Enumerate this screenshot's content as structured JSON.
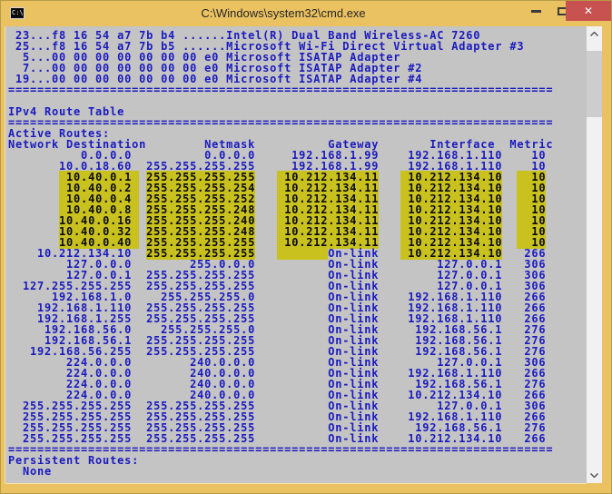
{
  "theme": {
    "titlebar_bg": "#ebc261",
    "close_bg": "#c85250",
    "console_bg": "#c4c4c4",
    "console_text": "#1a1ac0",
    "hl_bg": "#c9c11d",
    "hl_text": "#0a0a14",
    "sb_track": "#f1f1f1",
    "sb_thumb": "#cdcdcd"
  },
  "window": {
    "title": "C:\\Windows\\system32\\cmd.exe",
    "icon_glyph": "C:\\",
    "close_glyph": "✕"
  },
  "console": {
    "lines": [
      [
        {
          "t": " 23...f8 16 54 a7 7b b4 ......Intel(R) Dual Band Wireless-AC 7260"
        }
      ],
      [
        {
          "t": " 25...f8 16 54 a7 7b b5 ......Microsoft Wi-Fi Direct Virtual Adapter #3"
        }
      ],
      [
        {
          "t": "  5...00 00 00 00 00 00 00 e0 Microsoft ISATAP Adapter"
        }
      ],
      [
        {
          "t": "  7...00 00 00 00 00 00 00 e0 Microsoft ISATAP Adapter #2"
        }
      ],
      [
        {
          "t": " 19...00 00 00 00 00 00 00 e0 Microsoft ISATAP Adapter #4"
        }
      ],
      [
        {
          "t": "==========================================================================="
        }
      ],
      [
        {
          "t": ""
        }
      ],
      [
        {
          "t": "IPv4 Route Table"
        }
      ],
      [
        {
          "t": "==========================================================================="
        }
      ],
      [
        {
          "t": "Active Routes:"
        }
      ],
      [
        {
          "t": "Network Destination        Netmask          Gateway       Interface  Metric"
        }
      ],
      [
        {
          "t": "          0.0.0.0          0.0.0.0     192.168.1.99    192.168.1.110    10"
        }
      ],
      [
        {
          "t": "       10.0.18.60  255.255.255.255     192.168.1.99    192.168.1.110    10"
        }
      ],
      [
        {
          "t": "       "
        },
        {
          "t": " 10.40.0.1 ",
          "h": true
        },
        {
          "t": " "
        },
        {
          "t": "255.255.255.255",
          "h": true
        },
        {
          "t": "   "
        },
        {
          "t": " 10.212.134.11",
          "h": true
        },
        {
          "t": "   "
        },
        {
          "t": " 10.212.134.10",
          "h": true
        },
        {
          "t": "  "
        },
        {
          "t": "  10",
          "h": true
        }
      ],
      [
        {
          "t": "       "
        },
        {
          "t": " 10.40.0.2 ",
          "h": true
        },
        {
          "t": " "
        },
        {
          "t": "255.255.255.254",
          "h": true
        },
        {
          "t": "   "
        },
        {
          "t": " 10.212.134.11",
          "h": true
        },
        {
          "t": "   "
        },
        {
          "t": " 10.212.134.10",
          "h": true
        },
        {
          "t": "  "
        },
        {
          "t": "  10",
          "h": true
        }
      ],
      [
        {
          "t": "       "
        },
        {
          "t": " 10.40.0.4 ",
          "h": true
        },
        {
          "t": " "
        },
        {
          "t": "255.255.255.252",
          "h": true
        },
        {
          "t": "   "
        },
        {
          "t": " 10.212.134.11",
          "h": true
        },
        {
          "t": "   "
        },
        {
          "t": " 10.212.134.10",
          "h": true
        },
        {
          "t": "  "
        },
        {
          "t": "  10",
          "h": true
        }
      ],
      [
        {
          "t": "       "
        },
        {
          "t": " 10.40.0.8 ",
          "h": true
        },
        {
          "t": " "
        },
        {
          "t": "255.255.255.248",
          "h": true
        },
        {
          "t": "   "
        },
        {
          "t": " 10.212.134.11",
          "h": true
        },
        {
          "t": "   "
        },
        {
          "t": " 10.212.134.10",
          "h": true
        },
        {
          "t": "  "
        },
        {
          "t": "  10",
          "h": true
        }
      ],
      [
        {
          "t": "       "
        },
        {
          "t": "10.40.0.16 ",
          "h": true
        },
        {
          "t": " "
        },
        {
          "t": "255.255.255.240",
          "h": true
        },
        {
          "t": "   "
        },
        {
          "t": " 10.212.134.11",
          "h": true
        },
        {
          "t": "   "
        },
        {
          "t": " 10.212.134.10",
          "h": true
        },
        {
          "t": "  "
        },
        {
          "t": "  10",
          "h": true
        }
      ],
      [
        {
          "t": "       "
        },
        {
          "t": "10.40.0.32 ",
          "h": true
        },
        {
          "t": " "
        },
        {
          "t": "255.255.255.248",
          "h": true
        },
        {
          "t": "   "
        },
        {
          "t": " 10.212.134.11",
          "h": true
        },
        {
          "t": "   "
        },
        {
          "t": " 10.212.134.10",
          "h": true
        },
        {
          "t": "  "
        },
        {
          "t": "  10",
          "h": true
        }
      ],
      [
        {
          "t": "       "
        },
        {
          "t": "10.40.0.40 ",
          "h": true
        },
        {
          "t": " "
        },
        {
          "t": "255.255.255.255",
          "h": true
        },
        {
          "t": "   "
        },
        {
          "t": " 10.212.134.11",
          "h": true
        },
        {
          "t": "   "
        },
        {
          "t": " 10.212.134.10",
          "h": true
        },
        {
          "t": "  "
        },
        {
          "t": "  10",
          "h": true
        }
      ],
      [
        {
          "t": "    10.212.134.10  "
        },
        {
          "t": "255.255.255.255",
          "h": true
        },
        {
          "t": "   "
        },
        {
          "t": "       ",
          "h": true
        },
        {
          "t": "On-link"
        },
        {
          "t": "   "
        },
        {
          "t": " 10.212.134.10",
          "h": true
        },
        {
          "t": "   266"
        }
      ],
      [
        {
          "t": "        127.0.0.0        255.0.0.0          On-link        127.0.0.1   306"
        }
      ],
      [
        {
          "t": "        127.0.0.1  255.255.255.255          On-link        127.0.0.1   306"
        }
      ],
      [
        {
          "t": "  127.255.255.255  255.255.255.255          On-link        127.0.0.1   306"
        }
      ],
      [
        {
          "t": "      192.168.1.0    255.255.255.0          On-link    192.168.1.110   266"
        }
      ],
      [
        {
          "t": "    192.168.1.110  255.255.255.255          On-link    192.168.1.110   266"
        }
      ],
      [
        {
          "t": "    192.168.1.255  255.255.255.255          On-link    192.168.1.110   266"
        }
      ],
      [
        {
          "t": "     192.168.56.0    255.255.255.0          On-link     192.168.56.1   276"
        }
      ],
      [
        {
          "t": "     192.168.56.1  255.255.255.255          On-link     192.168.56.1   276"
        }
      ],
      [
        {
          "t": "   192.168.56.255  255.255.255.255          On-link     192.168.56.1   276"
        }
      ],
      [
        {
          "t": "        224.0.0.0        240.0.0.0          On-link        127.0.0.1   306"
        }
      ],
      [
        {
          "t": "        224.0.0.0        240.0.0.0          On-link    192.168.1.110   266"
        }
      ],
      [
        {
          "t": "        224.0.0.0        240.0.0.0          On-link     192.168.56.1   276"
        }
      ],
      [
        {
          "t": "        224.0.0.0        240.0.0.0          On-link    10.212.134.10   266"
        }
      ],
      [
        {
          "t": "  255.255.255.255  255.255.255.255          On-link        127.0.0.1   306"
        }
      ],
      [
        {
          "t": "  255.255.255.255  255.255.255.255          On-link    192.168.1.110   266"
        }
      ],
      [
        {
          "t": "  255.255.255.255  255.255.255.255          On-link     192.168.56.1   276"
        }
      ],
      [
        {
          "t": "  255.255.255.255  255.255.255.255          On-link    10.212.134.10   266"
        }
      ],
      [
        {
          "t": "==========================================================================="
        }
      ],
      [
        {
          "t": "Persistent Routes:"
        }
      ],
      [
        {
          "t": "  None"
        }
      ]
    ]
  }
}
